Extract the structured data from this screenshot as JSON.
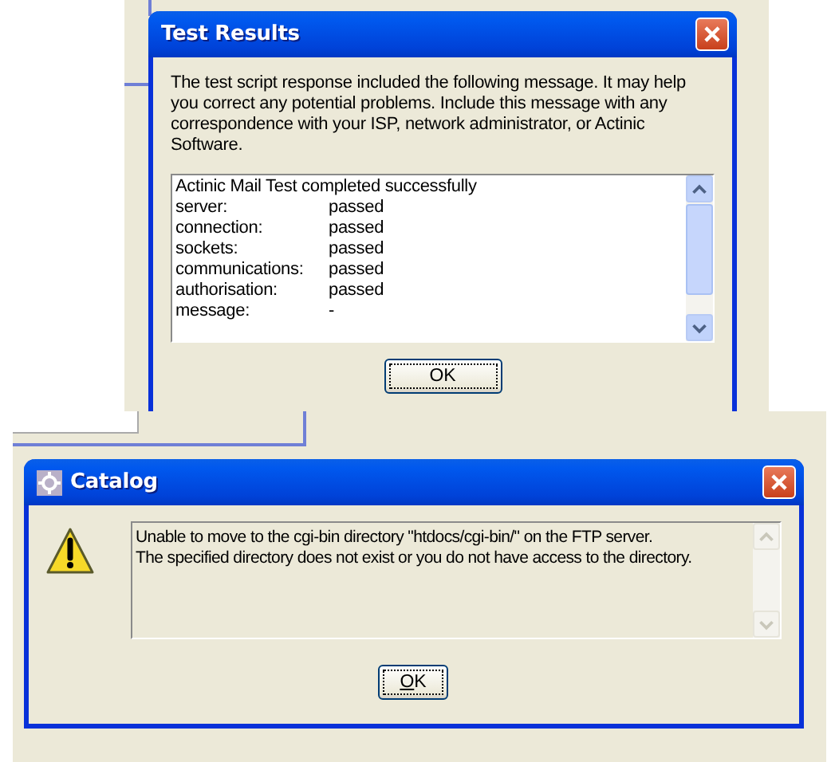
{
  "test_results": {
    "title": "Test Results",
    "message": "The test script response included the following message.  It may help you correct any potential problems.  Include this message with any correspondence with your ISP, network administrator, or Actinic Software.",
    "log": {
      "heading": "Actinic Mail Test completed successfully",
      "rows": [
        {
          "label": "server:",
          "value": "passed"
        },
        {
          "label": "connection:",
          "value": "passed"
        },
        {
          "label": "sockets:",
          "value": "passed"
        },
        {
          "label": "communications:",
          "value": "passed"
        },
        {
          "label": "authorisation:",
          "value": "passed"
        },
        {
          "label": "message:",
          "value": "-"
        }
      ]
    },
    "button": {
      "label": "OK",
      "focused": true
    }
  },
  "catalog": {
    "title": "Catalog",
    "message": "Unable to move to the cgi-bin directory \"htdocs/cgi-bin/\" on the FTP server.\nThe specified directory does not exist or you do not have access to the directory.",
    "button": {
      "label": "OK",
      "focused": true
    }
  }
}
